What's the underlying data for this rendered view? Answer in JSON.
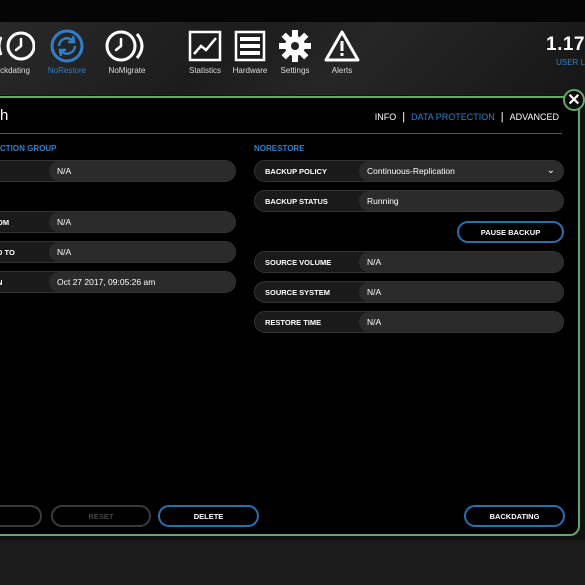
{
  "toolbar": {
    "items": [
      {
        "label": "ckdating",
        "icon": "backdating-icon"
      },
      {
        "label": "NoRestore",
        "icon": "norestore-icon",
        "active": true
      },
      {
        "label": "NoMigrate",
        "icon": "nomigrate-icon"
      },
      {
        "label": "Statistics",
        "icon": "statistics-icon"
      },
      {
        "label": "Hardware",
        "icon": "hardware-icon"
      },
      {
        "label": "Settings",
        "icon": "gear-icon"
      },
      {
        "label": "Alerts",
        "icon": "alert-icon"
      }
    ],
    "brand_number": "1.17",
    "brand_sub": "USER L"
  },
  "panel": {
    "title": "h",
    "close_label": "✕",
    "tabs": [
      "INFO",
      "DATA PROTECTION",
      "ADVANCED"
    ],
    "active_tab": "DATA PROTECTION"
  },
  "left": {
    "section_title": "CTION GROUP",
    "section_title_small": "",
    "rows": [
      {
        "label": "",
        "value": "N/A"
      },
      {
        "label": "OM",
        "value": "N/A"
      },
      {
        "label": "D TO",
        "value": "N/A"
      },
      {
        "label": "N",
        "value": "Oct 27 2017, 09:05:26 am"
      }
    ]
  },
  "right": {
    "section_title": "NORESTORE",
    "backup_policy": {
      "label": "BACKUP POLICY",
      "value": "Continuous-Replication"
    },
    "backup_status": {
      "label": "BACKUP STATUS",
      "value": "Running"
    },
    "pause_label": "PAUSE BACKUP",
    "rows": [
      {
        "label": "SOURCE VOLUME",
        "value": "N/A"
      },
      {
        "label": "SOURCE SYSTEM",
        "value": "N/A"
      },
      {
        "label": "RESTORE TIME",
        "value": "N/A"
      }
    ]
  },
  "footer": {
    "button1": "",
    "reset": "RESET",
    "delete": "DELETE",
    "backdating": "BACKDATING"
  },
  "colors": {
    "accent": "#2f7fc9",
    "panel_border": "#5fa868"
  }
}
